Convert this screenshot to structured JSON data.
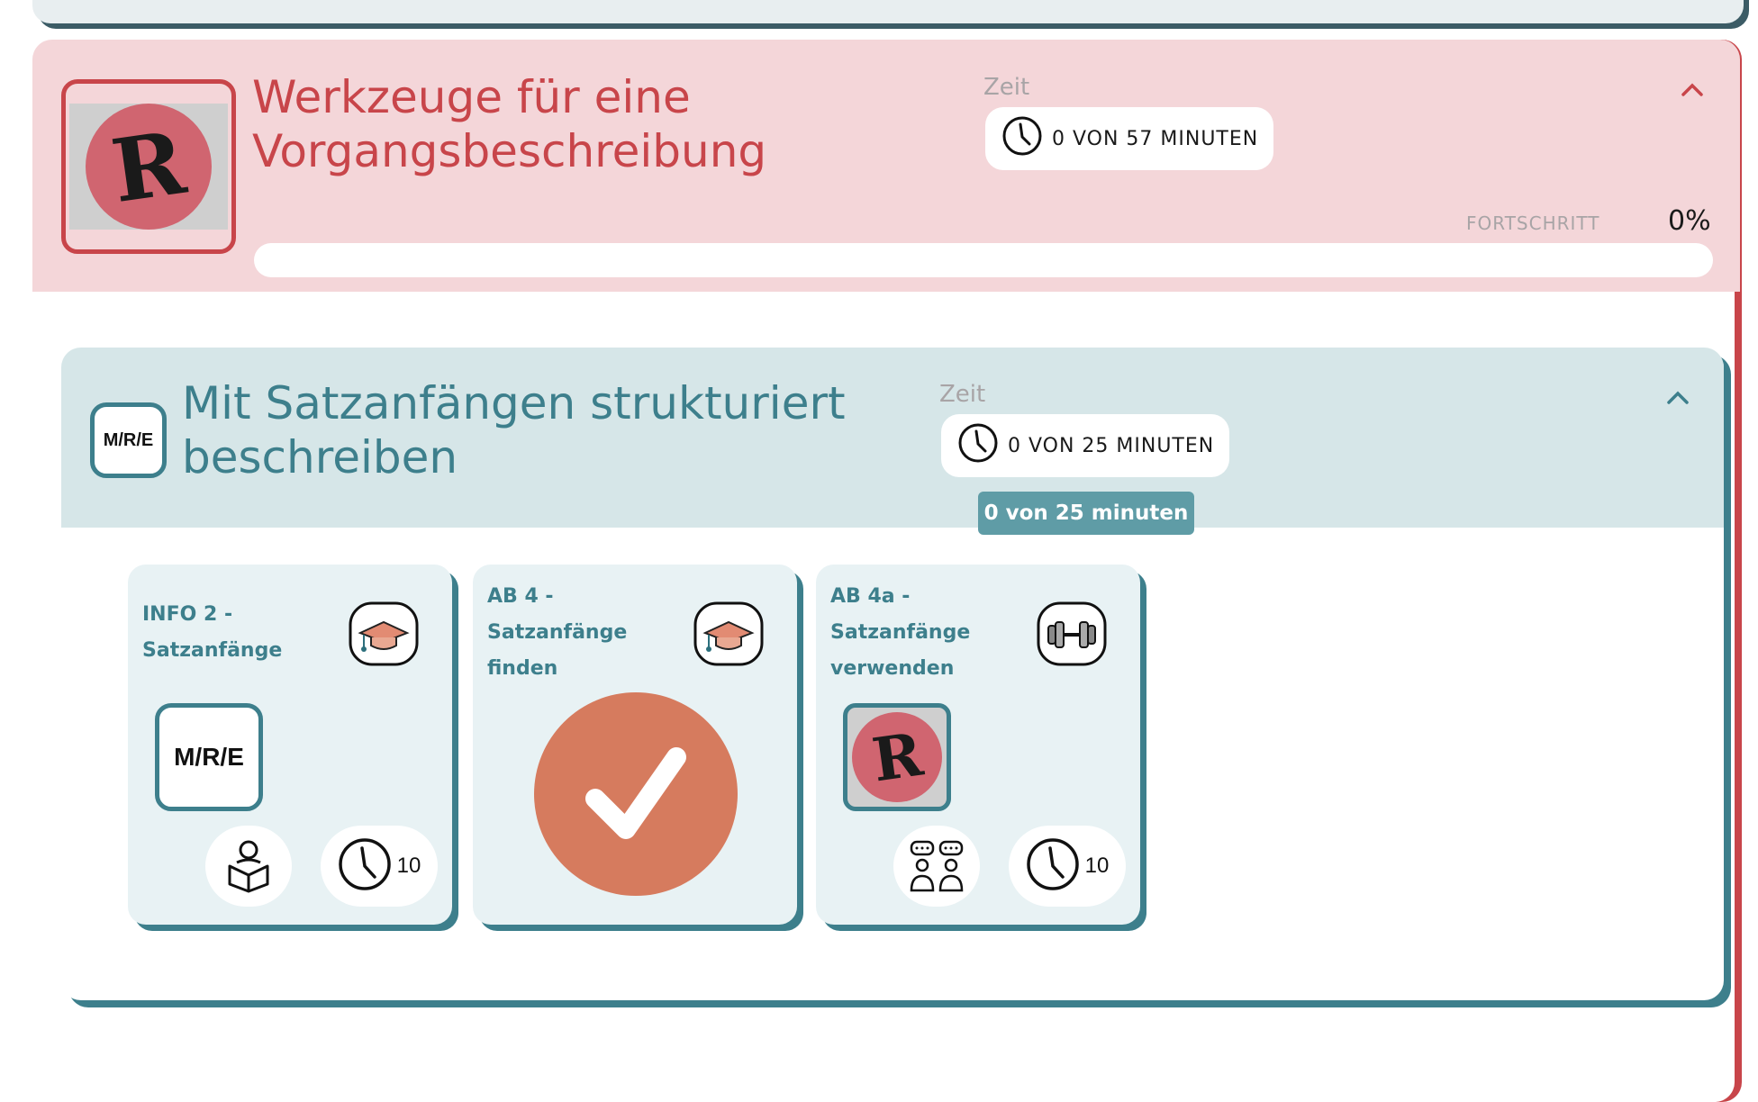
{
  "section": {
    "title": "Werkzeuge für eine Vorgangsbeschreibung",
    "logo_letter": "R",
    "time_label": "Zeit",
    "time_value": "0 VON 57 MINUTEN",
    "progress_label": "FORTSCHRITT",
    "progress_percent": "0%",
    "progress_fraction": 0,
    "accent_color": "#c8454a"
  },
  "subsection": {
    "badge": "M/R/E",
    "title": "Mit Satzanfängen strukturiert beschreiben",
    "time_label": "Zeit",
    "time_value": "0 VON 25 MINUTEN",
    "tooltip": "0 von 25 minuten",
    "accent_color": "#3d7f8c"
  },
  "cards": [
    {
      "title": "INFO 2 - Satzanfänge",
      "kind_icon": "graduation-cap-icon",
      "badge": "M/R/E",
      "mode_icon": "reading-person-icon",
      "duration": "10"
    },
    {
      "title": "AB 4 - Satzanfänge finden",
      "kind_icon": "graduation-cap-icon",
      "status": "completed",
      "status_icon": "checkmark-icon"
    },
    {
      "title": "AB 4a - Satzanfänge verwenden",
      "kind_icon": "dumbbell-icon",
      "badge_letter": "R",
      "mode_icon": "partner-discussion-icon",
      "duration": "10"
    }
  ]
}
